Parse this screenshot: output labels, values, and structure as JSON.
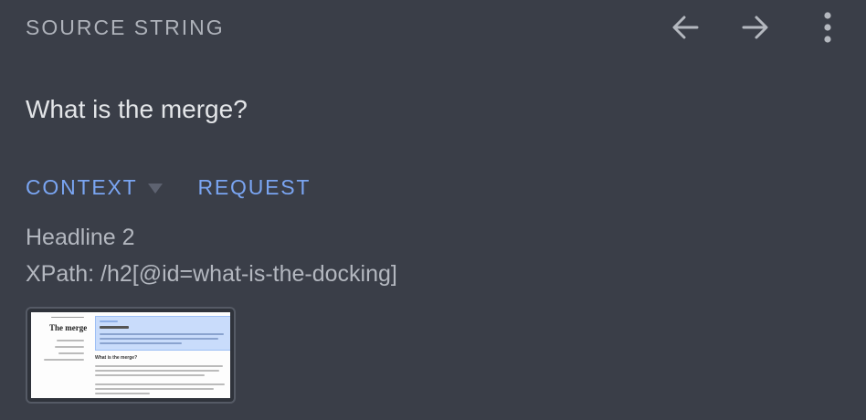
{
  "header": {
    "title": "SOURCE STRING",
    "back_icon": "arrow-left-icon",
    "forward_icon": "arrow-right-icon",
    "menu_icon": "more-vert-icon"
  },
  "source": {
    "text": "What is the merge?"
  },
  "tabs": [
    {
      "label": "CONTEXT",
      "active": true
    },
    {
      "label": "REQUEST",
      "active": false
    }
  ],
  "context": {
    "element": "Headline 2",
    "xpath": "XPath: /h2[@id=what-is-the-docking]"
  },
  "thumbnail": {
    "page_title": "The merge",
    "heading": "What is the merge?"
  },
  "colors": {
    "background": "#3a3e48",
    "accent": "#7aa5f2",
    "muted_text": "#aeb2ba",
    "primary_text": "#e3e5e8"
  }
}
